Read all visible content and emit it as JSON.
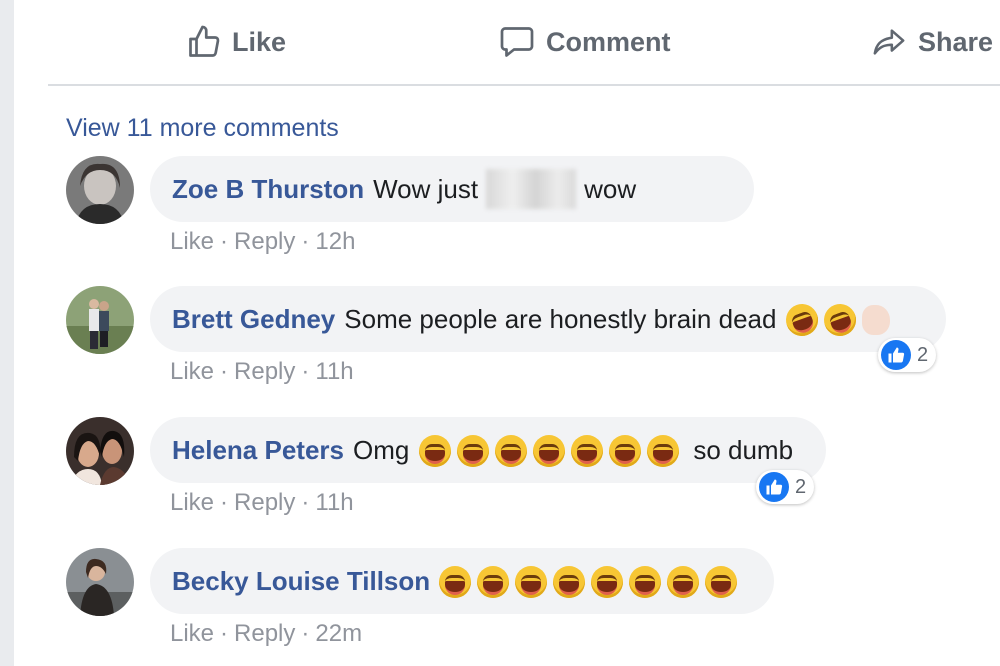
{
  "actions": {
    "like": "Like",
    "comment": "Comment",
    "share": "Share"
  },
  "view_more": "View 11 more comments",
  "comments": [
    {
      "author": "Zoe B Thurston",
      "text_before": "Wow just",
      "text_after": "wow",
      "meta": {
        "like": "Like",
        "reply": "Reply",
        "time": "12h"
      }
    },
    {
      "author": "Brett Gedney",
      "text": "Some people are honestly brain dead",
      "reaction_count": "2",
      "meta": {
        "like": "Like",
        "reply": "Reply",
        "time": "11h"
      }
    },
    {
      "author": "Helena Peters",
      "text_before": "Omg",
      "text_after": "so dumb",
      "reaction_count": "2",
      "meta": {
        "like": "Like",
        "reply": "Reply",
        "time": "11h"
      }
    },
    {
      "author": "Becky Louise Tillson",
      "meta": {
        "like": "Like",
        "reply": "Reply",
        "time": "22m"
      }
    }
  ],
  "meta_separator": "·",
  "colors": {
    "link": "#385898",
    "muted": "#90949c",
    "bubble": "#f2f3f5",
    "like_blue": "#1877f2"
  }
}
